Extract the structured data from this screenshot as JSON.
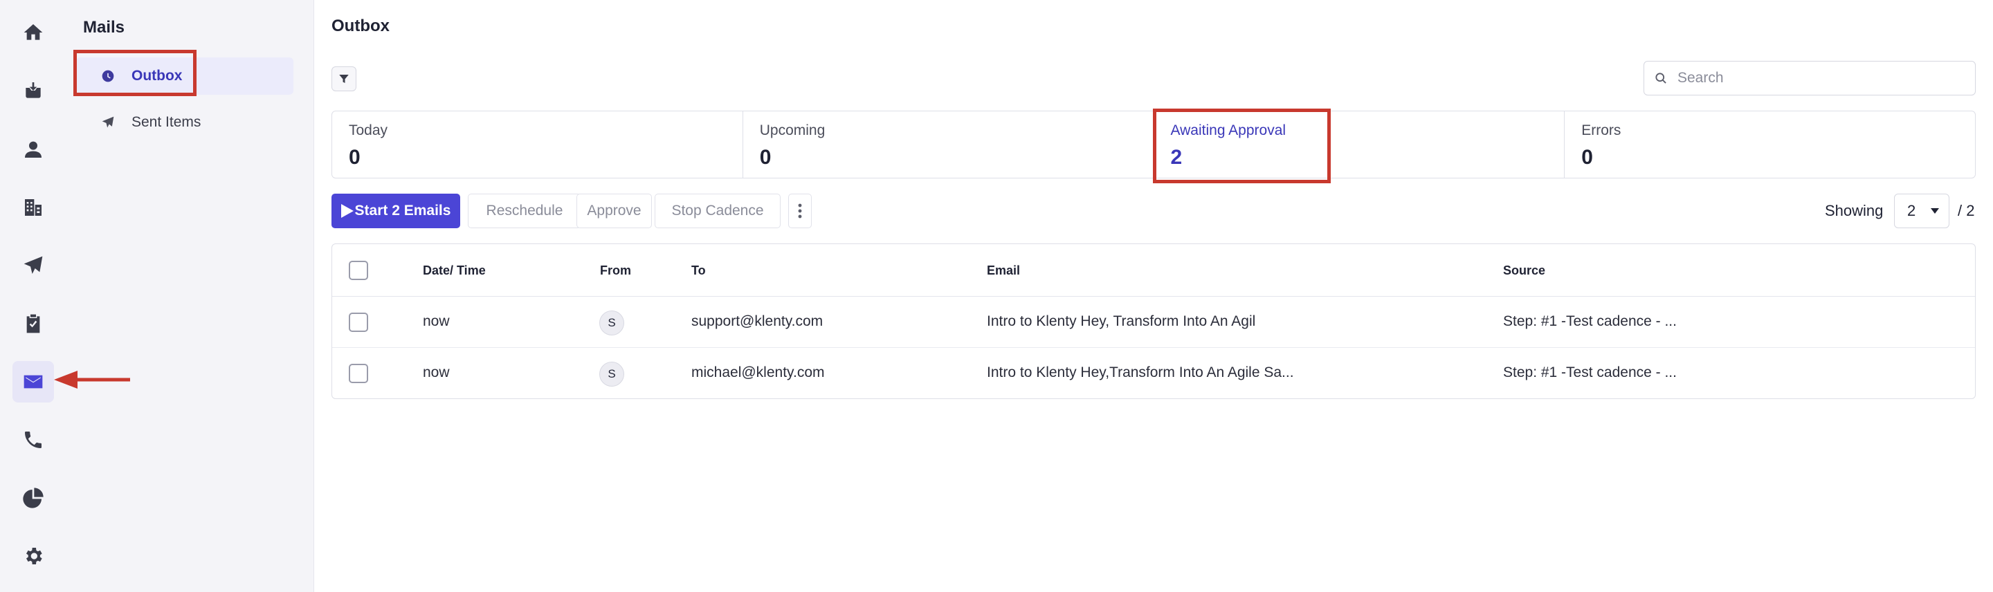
{
  "nav": {
    "items": [
      {
        "icon": "home-icon"
      },
      {
        "icon": "inbox-icon"
      },
      {
        "icon": "user-icon"
      },
      {
        "icon": "building-icon"
      },
      {
        "icon": "send-icon"
      },
      {
        "icon": "clipboard-icon"
      },
      {
        "icon": "mail-icon",
        "active": true
      },
      {
        "icon": "phone-icon"
      },
      {
        "icon": "pie-chart-icon"
      },
      {
        "icon": "gear-icon"
      }
    ]
  },
  "mails_panel": {
    "title": "Mails",
    "items": [
      {
        "label": "Outbox",
        "icon": "clock-icon",
        "active": true
      },
      {
        "label": "Sent Items",
        "icon": "send-icon"
      }
    ]
  },
  "main": {
    "title": "Outbox",
    "search": {
      "placeholder": "Search",
      "value": ""
    },
    "stats": [
      {
        "label": "Today",
        "value": "0"
      },
      {
        "label": "Upcoming",
        "value": "0"
      },
      {
        "label": "Awaiting Approval",
        "value": "2"
      },
      {
        "label": "Errors",
        "value": "0"
      }
    ],
    "toolbar": {
      "start_label": "Start 2 Emails",
      "reschedule_label": "Reschedule",
      "approve_label": "Approve",
      "stop_label": "Stop Cadence",
      "showing_label": "Showing",
      "page_value": "2",
      "page_total": "/ 2"
    },
    "table": {
      "headers": {
        "datetime": "Date/ Time",
        "from": "From",
        "to": "To",
        "email": "Email",
        "source": "Source"
      },
      "rows": [
        {
          "datetime": "now",
          "from": "S",
          "to": "support@klenty.com",
          "email": "Intro to Klenty  Hey, Transform Into An Agil",
          "source": "Step: #1 -Test cadence - ..."
        },
        {
          "datetime": "now",
          "from": "S",
          "to": "michael@klenty.com",
          "email": "Intro to Klenty Hey,Transform Into An Agile Sa...",
          "source": "Step: #1 -Test cadence - ..."
        }
      ]
    }
  },
  "colors": {
    "accent": "#4b45d6",
    "annotation": "#c8392e",
    "rail_bg": "#f4f4f8"
  }
}
